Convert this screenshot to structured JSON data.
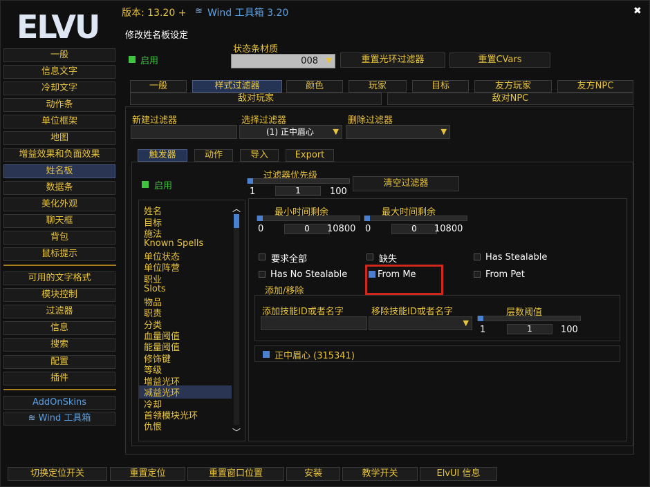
{
  "header": {
    "version_label": "版本: 13.20 +",
    "wind_label": "Wind 工具箱 3.20",
    "close": "✖"
  },
  "logo": "ELVU",
  "sidebar": {
    "items": [
      "一般",
      "信息文字",
      "冷却文字",
      "动作条",
      "单位框架",
      "地图",
      "增益效果和负面效果",
      "姓名板",
      "数据条",
      "美化外观",
      "聊天框",
      "背包",
      "鼠标提示"
    ],
    "items2": [
      "可用的文字格式",
      "模块控制",
      "过滤器",
      "信息",
      "搜索",
      "配置",
      "插件"
    ],
    "items3": [
      "AddOnSkins",
      "Wind 工具箱"
    ]
  },
  "main": {
    "title": "修改姓名板设定",
    "enable_label": "启用",
    "statusbar_label": "状态条材质",
    "statusbar_value": "008",
    "reset_aura_filter": "重置光环过滤器",
    "reset_cvars": "重置CVars",
    "tabs_row1": [
      "一般",
      "样式过滤器",
      "颜色",
      "玩家",
      "目标",
      "友方玩家",
      "友方NPC"
    ],
    "tabs_row2": [
      "敌对玩家",
      "敌对NPC"
    ],
    "new_filter_label": "新建过滤器",
    "select_filter_label": "选择过滤器",
    "select_filter_value": "(1) 正中眉心",
    "delete_filter_label": "删除过滤器",
    "subtabs": [
      "触发器",
      "动作",
      "导入",
      "Export"
    ],
    "trigger_enable": "启用",
    "priority_label": "过滤器优先级",
    "priority_min": "1",
    "priority_value": "1",
    "priority_max": "100",
    "clear_filter": "清空过滤器",
    "trigger_list": [
      "姓名",
      "目标",
      "施法",
      "Known Spells",
      "单位状态",
      "单位阵营",
      "职业",
      "Slots",
      "物品",
      "职责",
      "分类",
      "血量阈值",
      "能量阈值",
      "修饰键",
      "等级",
      "增益光环",
      "减益光环",
      "冷却",
      "首领模块光环",
      "仇恨"
    ],
    "selected_trigger": "减益光环",
    "min_time_label": "最小时间剩余",
    "min_time_min": "0",
    "min_time_value": "0",
    "min_time_max": "10800",
    "max_time_label": "最大时间剩余",
    "max_time_min": "0",
    "max_time_value": "0",
    "max_time_max": "10800",
    "require_all": "要求全部",
    "missing": "缺失",
    "has_stealable": "Has Stealable",
    "has_no_stealable": "Has No Stealable",
    "from_me": "From Me",
    "from_pet": "From Pet",
    "add_remove_label": "添加/移除",
    "add_spell_label": "添加技能ID或者名字",
    "remove_spell_label": "移除技能ID或者名字",
    "stack_label": "层数阈值",
    "stack_min": "1",
    "stack_value": "1",
    "stack_max": "100",
    "spell_entry": "正中眉心 (315341)"
  },
  "footer": {
    "buttons": [
      "切换定位开关",
      "重置定位",
      "重置窗口位置",
      "安装",
      "教学开关",
      "ElvUI 信息"
    ]
  },
  "colors": {
    "accent": "#e8c43b",
    "active": "#2a3553",
    "highlight_red": "#d0281c",
    "green": "#3ec43e",
    "blue": "#4b7fd0"
  }
}
